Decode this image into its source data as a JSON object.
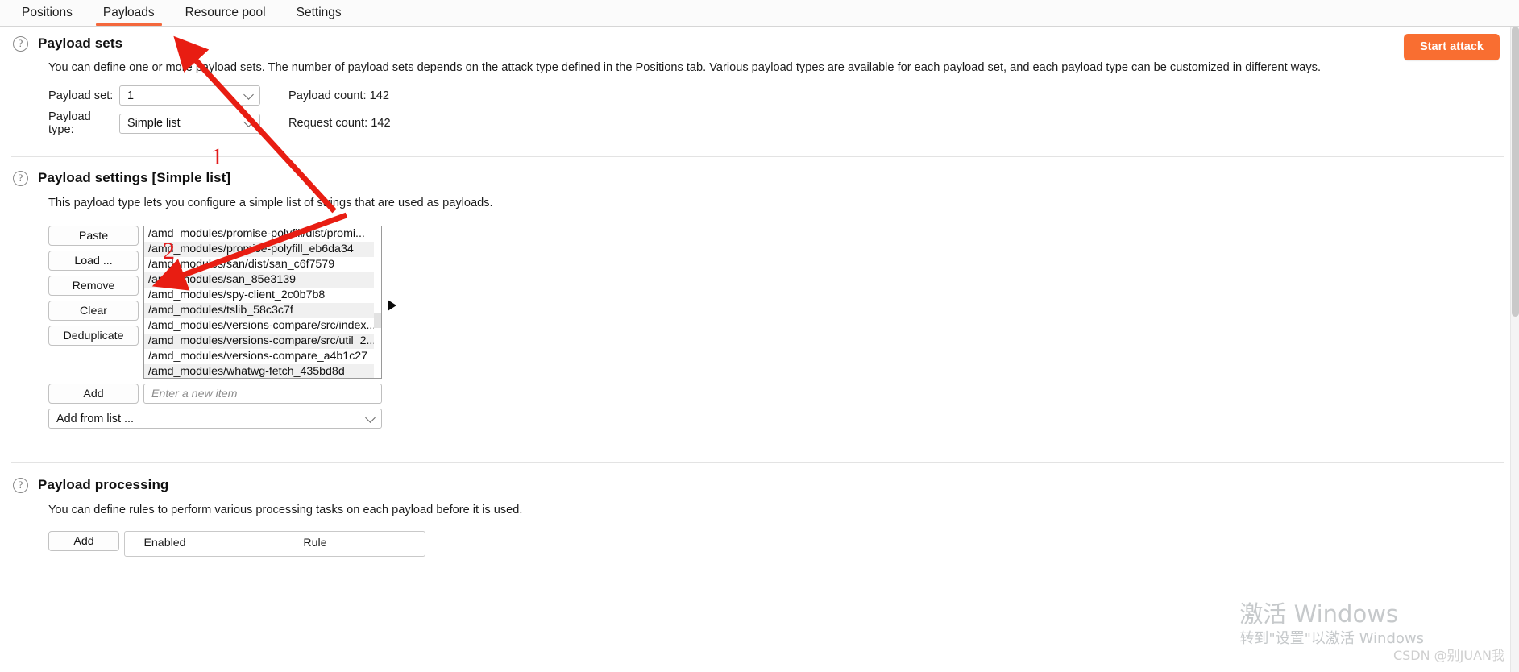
{
  "tabs": [
    {
      "label": "Positions",
      "active": false
    },
    {
      "label": "Payloads",
      "active": true
    },
    {
      "label": "Resource pool",
      "active": false
    },
    {
      "label": "Settings",
      "active": false
    }
  ],
  "start_attack_label": "Start attack",
  "accent_color": "#f96e31",
  "payload_sets": {
    "help_icon": "question-mark-icon",
    "title": "Payload sets",
    "description": "You can define one or more payload sets. The number of payload sets depends on the attack type defined in the Positions tab. Various payload types are available for each payload set, and each payload type can be customized in different ways.",
    "payload_set_label": "Payload set:",
    "payload_set_value": "1",
    "payload_type_label": "Payload type:",
    "payload_type_value": "Simple list",
    "payload_count_label": "Payload count:  142",
    "request_count_label": "Request count:  142"
  },
  "payload_settings": {
    "help_icon": "question-mark-icon",
    "title": "Payload settings [Simple list]",
    "description": "This payload type lets you configure a simple list of strings that are used as payloads.",
    "buttons": [
      "Paste",
      "Load ...",
      "Remove",
      "Clear",
      "Deduplicate"
    ],
    "items": [
      "/amd_modules/promise-polyfill/dist/promi...",
      "/amd_modules/promise-polyfill_eb6da34",
      "/amd_modules/san/dist/san_c6f7579",
      "/amd_modules/san_85e3139",
      "/amd_modules/spy-client_2c0b7b8",
      "/amd_modules/tslib_58c3c7f",
      "/amd_modules/versions-compare/src/index...",
      "/amd_modules/versions-compare/src/util_2...",
      "/amd_modules/versions-compare_a4b1c27",
      "/amd_modules/whatwg-fetch_435bd8d"
    ],
    "add_label": "Add",
    "new_item_placeholder": "Enter a new item",
    "add_from_list_label": "Add from list ..."
  },
  "payload_processing": {
    "help_icon": "question-mark-icon",
    "title": "Payload processing",
    "description": "You can define rules to perform various processing tasks on each payload before it is used.",
    "add_label": "Add",
    "columns": [
      "Enabled",
      "Rule"
    ]
  },
  "annotations": [
    {
      "label": "1"
    },
    {
      "label": "2"
    }
  ],
  "watermark": {
    "line1": "激活 Windows",
    "line2": "转到\"设置\"以激活 Windows",
    "credit": "CSDN @别JUAN我"
  }
}
